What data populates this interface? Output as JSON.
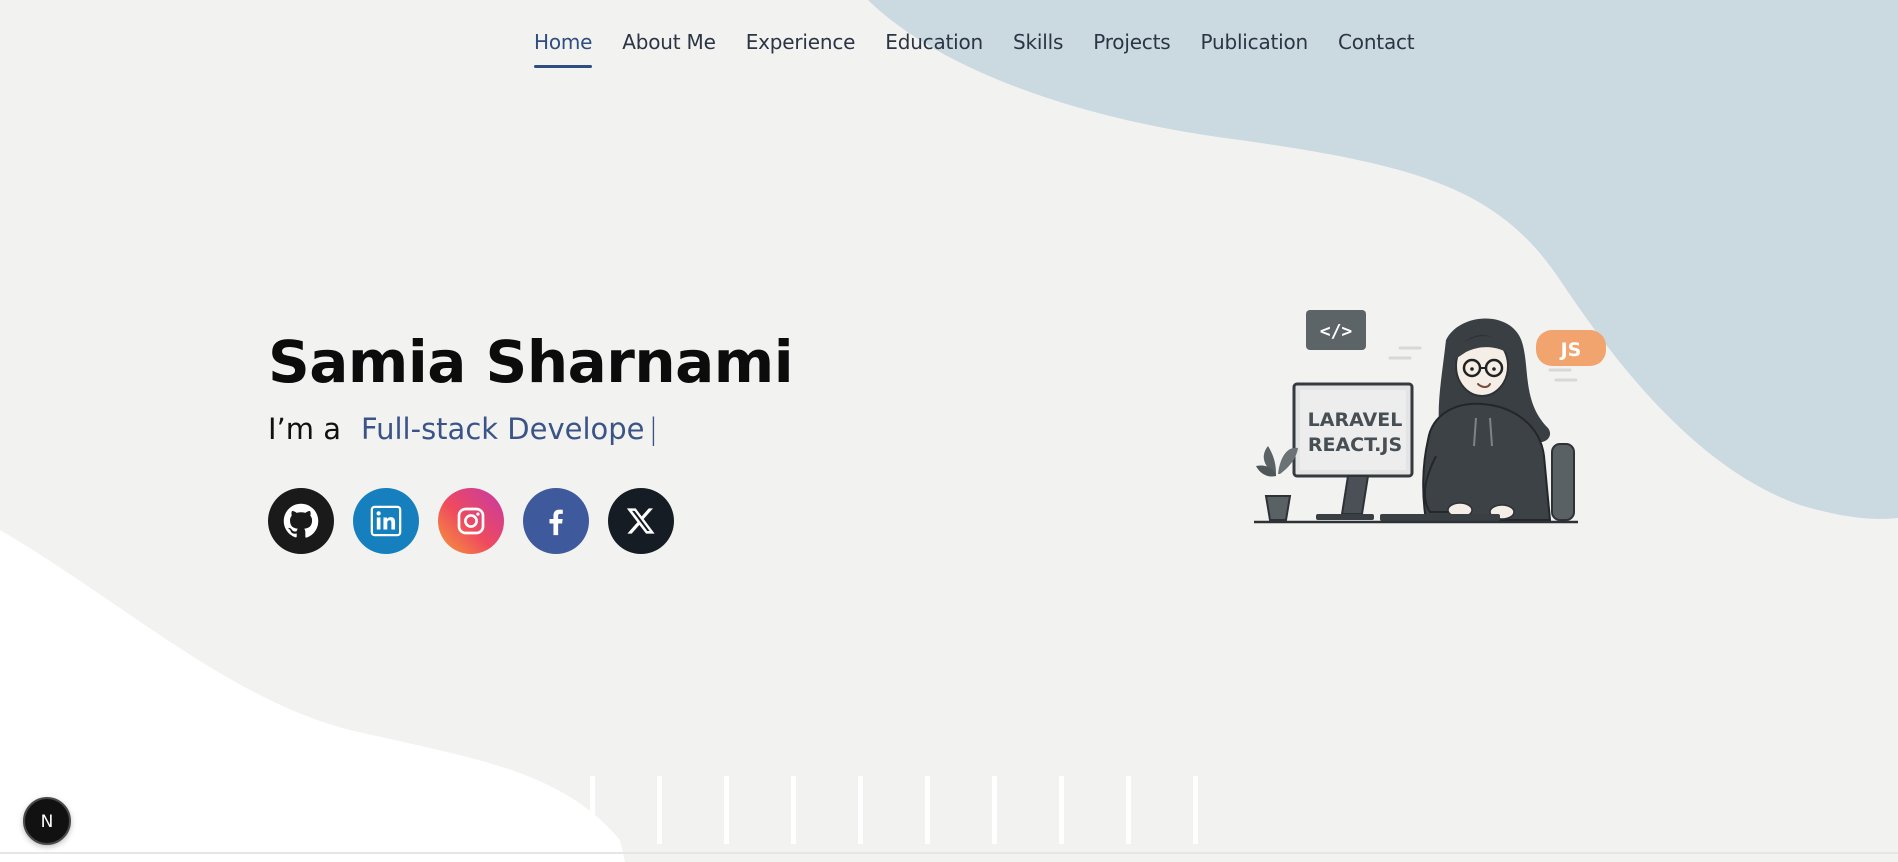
{
  "nav": {
    "items": [
      {
        "label": "Home",
        "active": true
      },
      {
        "label": "About Me",
        "active": false
      },
      {
        "label": "Experience",
        "active": false
      },
      {
        "label": "Education",
        "active": false
      },
      {
        "label": "Skills",
        "active": false
      },
      {
        "label": "Projects",
        "active": false
      },
      {
        "label": "Publication",
        "active": false
      },
      {
        "label": "Contact",
        "active": false
      }
    ]
  },
  "hero": {
    "name": "Samia Sharnami",
    "role_prefix": "I’m a",
    "role_typed": "Full-stack Develope",
    "cursor": "|"
  },
  "socials": [
    {
      "icon": "github-icon",
      "color": "#1a1a1a"
    },
    {
      "icon": "linkedin-icon",
      "color": "#1580bd"
    },
    {
      "icon": "instagram-icon",
      "color": "#e1306c"
    },
    {
      "icon": "facebook-icon",
      "color": "#3f5a9c"
    },
    {
      "icon": "x-icon",
      "color": "#161c24"
    }
  ],
  "illustration": {
    "code_tag": "</>",
    "js_badge": "JS",
    "monitor_line1": "LARAVEL",
    "monitor_line2": "REACT.JS"
  },
  "badge": {
    "letter": "N"
  },
  "colors": {
    "accent": "#2f4d7e",
    "blob": "#cbd9e0",
    "background": "#f2f2f1"
  }
}
